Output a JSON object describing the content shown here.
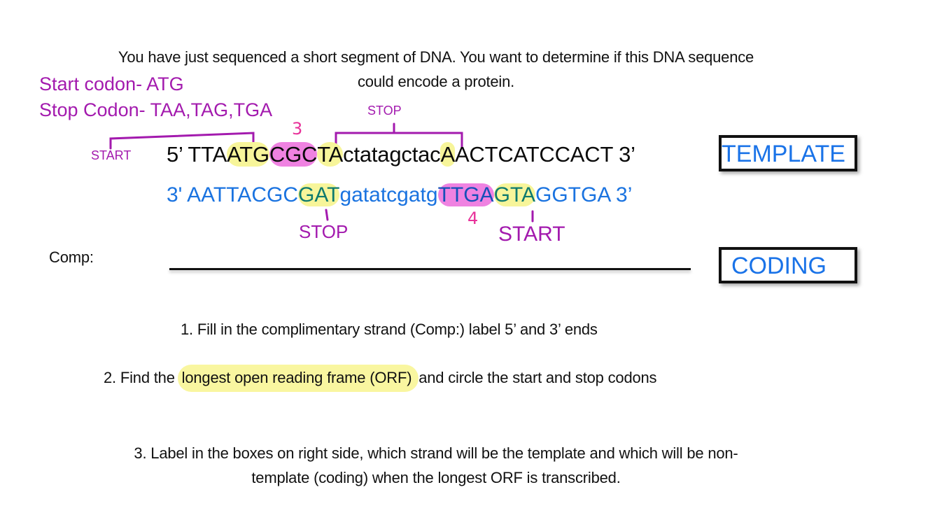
{
  "intro": {
    "line1": "You have just sequenced a short segment of DNA.  You want to determine if this DNA sequence",
    "line2": "could encode a protein."
  },
  "legend": {
    "start_codon": "Start codon- ATG",
    "stop_codon": "Stop Codon- TAA,TAG,TGA"
  },
  "annotations": {
    "top_start": "START",
    "top_stop": "STOP",
    "top_frame_number": "3",
    "bottom_stop": "STOP",
    "bottom_start": "START",
    "bottom_frame_number": "4"
  },
  "top_strand": {
    "prefix": "5’ TTA",
    "seg_atg": "ATG",
    "seg_cgc": "CGC",
    "seg_ta": "TA",
    "mid_lower": "ctatagctac",
    "seg_a": "A",
    "suffix": "ACTCATCCACT  3’"
  },
  "bottom_strand": {
    "prefix": "3' AATTACGC",
    "seg_gat": "GAT",
    "mid_lower": "gatatcgatg",
    "seg_ttga": "TTGA",
    "seg_gta": "GTA",
    "suffix": "GGTGA 3’"
  },
  "boxes": {
    "top": "TEMPLATE",
    "bottom": "CODING"
  },
  "comp": {
    "label": "Comp:"
  },
  "questions": {
    "q1": "1.  Fill in the complimentary  strand (Comp:) label 5’ and 3’ ends",
    "q2_prefix": "2.   Find the ",
    "q2_highlight": "longest open reading frame (ORF) ",
    "q2_suffix": "and circle the start and stop codons",
    "q3_line1": "3.  Label in the boxes on right side, which strand will be the template and which will be non-",
    "q3_line2": "template (coding) when the longest ORF is transcribed."
  },
  "colors": {
    "annotation_purple": "#a31aae",
    "handwriting_pink": "#e8329a",
    "highlight_yellow": "#f7f59a",
    "highlight_pink": "#ef82e1",
    "strand_blue": "#1a73e0"
  }
}
